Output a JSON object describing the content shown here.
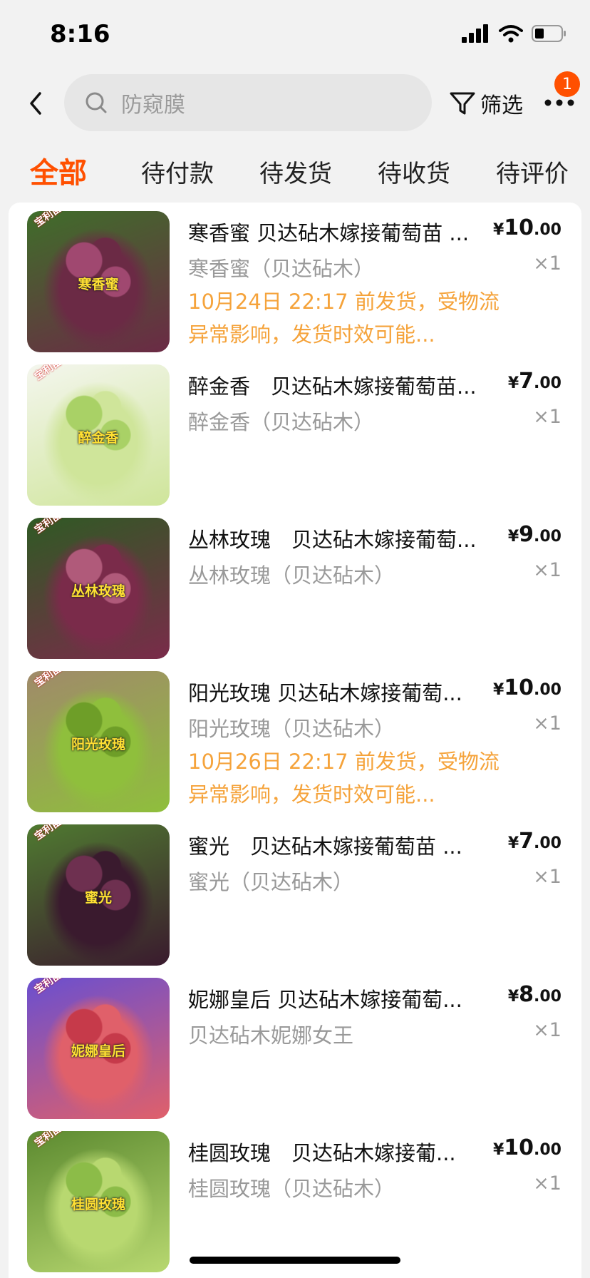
{
  "status_bar": {
    "time": "8:16"
  },
  "header": {
    "search_placeholder": "防窥膜",
    "filter_label": "筛选",
    "badge_count": "1"
  },
  "tabs": [
    {
      "label": "全部",
      "active": true
    },
    {
      "label": "待付款"
    },
    {
      "label": "待发货"
    },
    {
      "label": "待收货"
    },
    {
      "label": "待评价"
    }
  ],
  "currency_symbol": "¥",
  "items": [
    {
      "title": "寒香蜜 贝达砧木嫁接葡萄苗 ...",
      "price_int": "10",
      "price_dec": ".00",
      "spec": "寒香蜜（贝达砧木）",
      "qty": "×1",
      "notice": "10月24日 22:17 前发货，受物流异常影响，发货时效可能...",
      "thumb_label": "寒香蜜",
      "thumb_tag": "宝利苗木",
      "colors": [
        "#6b2a45",
        "#a04870",
        "#3f6e2a"
      ]
    },
    {
      "title": "醉金香　贝达砧木嫁接葡萄苗...",
      "price_int": "7",
      "price_dec": ".00",
      "spec": "醉金香（贝达砧木）",
      "qty": "×1",
      "notice": "",
      "thumb_label": "醉金香",
      "thumb_tag": "宝利苗木",
      "colors": [
        "#cfe59a",
        "#a9d166",
        "#f4f6ee"
      ]
    },
    {
      "title": "丛林玫瑰　贝达砧木嫁接葡萄...",
      "price_int": "9",
      "price_dec": ".00",
      "spec": "丛林玫瑰（贝达砧木）",
      "qty": "×1",
      "notice": "",
      "thumb_label": "丛林玫瑰",
      "thumb_tag": "宝利苗木",
      "colors": [
        "#7a2b4a",
        "#b05a7a",
        "#2f5a24"
      ]
    },
    {
      "title": "阳光玫瑰 贝达砧木嫁接葡萄...",
      "price_int": "10",
      "price_dec": ".00",
      "spec": "阳光玫瑰（贝达砧木）",
      "qty": "×1",
      "notice": "10月26日 22:17 前发货，受物流异常影响，发货时效可能...",
      "thumb_label": "阳光玫瑰",
      "thumb_tag": "宝利苗木",
      "colors": [
        "#8fbf3c",
        "#6e9e28",
        "#a08a6a"
      ]
    },
    {
      "title": "蜜光　贝达砧木嫁接葡萄苗 ...",
      "price_int": "7",
      "price_dec": ".00",
      "spec": "蜜光（贝达砧木）",
      "qty": "×1",
      "notice": "",
      "thumb_label": "蜜光",
      "thumb_tag": "宝利苗木",
      "colors": [
        "#3a1a2e",
        "#6e3050",
        "#4f7a30"
      ]
    },
    {
      "title": "妮娜皇后 贝达砧木嫁接葡萄...",
      "price_int": "8",
      "price_dec": ".00",
      "spec": "贝达砧木妮娜女王",
      "qty": "×1",
      "notice": "",
      "thumb_label": "妮娜皇后",
      "thumb_tag": "宝利苗木",
      "colors": [
        "#e0606a",
        "#c63a4a",
        "#6a4fd0"
      ]
    },
    {
      "title": "桂圆玫瑰　贝达砧木嫁接葡...",
      "price_int": "10",
      "price_dec": ".00",
      "spec": "桂圆玫瑰（贝达砧木）",
      "qty": "×1",
      "notice": "",
      "thumb_label": "桂圆玫瑰",
      "thumb_tag": "宝利苗木",
      "colors": [
        "#b8d870",
        "#8cbc48",
        "#5c8a30"
      ]
    }
  ]
}
